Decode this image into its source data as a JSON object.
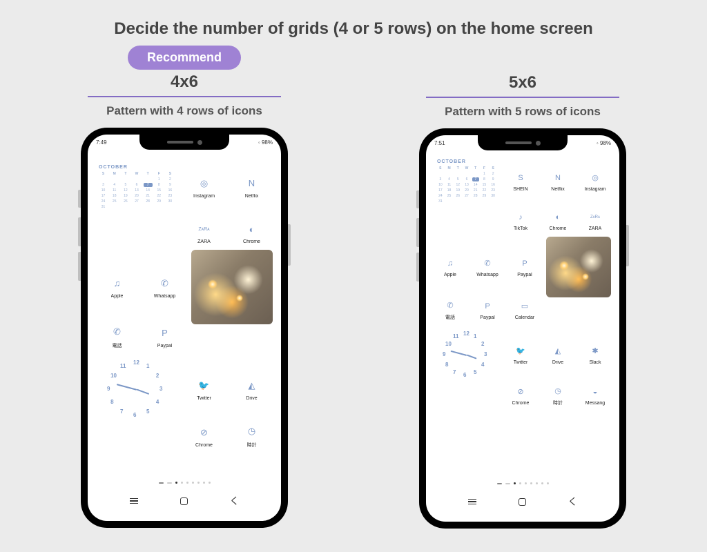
{
  "title": "Decide the number of grids (4 or 5 rows) on the home screen",
  "recommend_label": "Recommend",
  "left": {
    "grid": "4x6",
    "pattern": "Pattern with 4 rows of icons",
    "status_time": "7:49",
    "status_batt": "98%",
    "calendar_month": "OCTOBER",
    "calendar_today": "7",
    "apps_r1": [
      {
        "label": "Instagram",
        "icon": "◎"
      },
      {
        "label": "Netflix",
        "icon": "N"
      }
    ],
    "apps_r2": [
      {
        "label": "ZARA",
        "icon": "ZᴀRᴀ"
      },
      {
        "label": "Chrome",
        "icon": "◐"
      }
    ],
    "apps_r3": [
      {
        "label": "Apple",
        "icon": "♫"
      },
      {
        "label": "Whatsapp",
        "icon": "✆"
      }
    ],
    "apps_r4": [
      {
        "label": "電話",
        "icon": "✆"
      },
      {
        "label": "Paypal",
        "icon": "P"
      }
    ],
    "apps_r5": [
      {
        "label": "Twitter",
        "icon": "🐦"
      },
      {
        "label": "Drive",
        "icon": "◭"
      }
    ],
    "apps_r6": [
      {
        "label": "Chrome",
        "icon": "⊘"
      },
      {
        "label": "時計",
        "icon": "◷"
      }
    ]
  },
  "right": {
    "grid": "5x6",
    "pattern": "Pattern with 5 rows of icons",
    "status_time": "7:51",
    "status_batt": "98%",
    "calendar_month": "OCTOBER",
    "calendar_today": "7",
    "apps_r1": [
      {
        "label": "SHEIN",
        "icon": "S"
      },
      {
        "label": "Netflix",
        "icon": "N"
      },
      {
        "label": "Instagram",
        "icon": "◎"
      }
    ],
    "apps_r2": [
      {
        "label": "TikTok",
        "icon": "♪"
      },
      {
        "label": "Chrome",
        "icon": "◐"
      },
      {
        "label": "ZARA",
        "icon": "ZᴀRᴀ"
      }
    ],
    "apps_r3": [
      {
        "label": "Apple",
        "icon": "♫"
      },
      {
        "label": "Whatsapp",
        "icon": "✆"
      },
      {
        "label": "Paypal",
        "icon": "P"
      }
    ],
    "apps_r4": [
      {
        "label": "電話",
        "icon": "✆"
      },
      {
        "label": "Paypal",
        "icon": "P"
      },
      {
        "label": "Calendar",
        "icon": "▭"
      }
    ],
    "apps_r5": [
      {
        "label": "Twitter",
        "icon": "🐦"
      },
      {
        "label": "Drive",
        "icon": "◭"
      },
      {
        "label": "Slack",
        "icon": "✱"
      }
    ],
    "apps_r6": [
      {
        "label": "Chrome",
        "icon": "⊘"
      },
      {
        "label": "時計",
        "icon": "◷"
      },
      {
        "label": "Messang",
        "icon": "◒"
      }
    ]
  },
  "calendar_days": [
    "S",
    "M",
    "T",
    "W",
    "T",
    "F",
    "S"
  ],
  "calendar_dates": [
    "",
    "",
    "",
    "",
    "",
    "1",
    "2",
    "3",
    "4",
    "5",
    "6",
    "7",
    "8",
    "9",
    "10",
    "11",
    "12",
    "13",
    "14",
    "15",
    "16",
    "17",
    "18",
    "19",
    "20",
    "21",
    "22",
    "23",
    "24",
    "25",
    "26",
    "27",
    "28",
    "29",
    "30",
    "31"
  ],
  "clock_numbers": [
    "12",
    "1",
    "2",
    "3",
    "4",
    "5",
    "6",
    "7",
    "8",
    "9",
    "10",
    "11"
  ]
}
